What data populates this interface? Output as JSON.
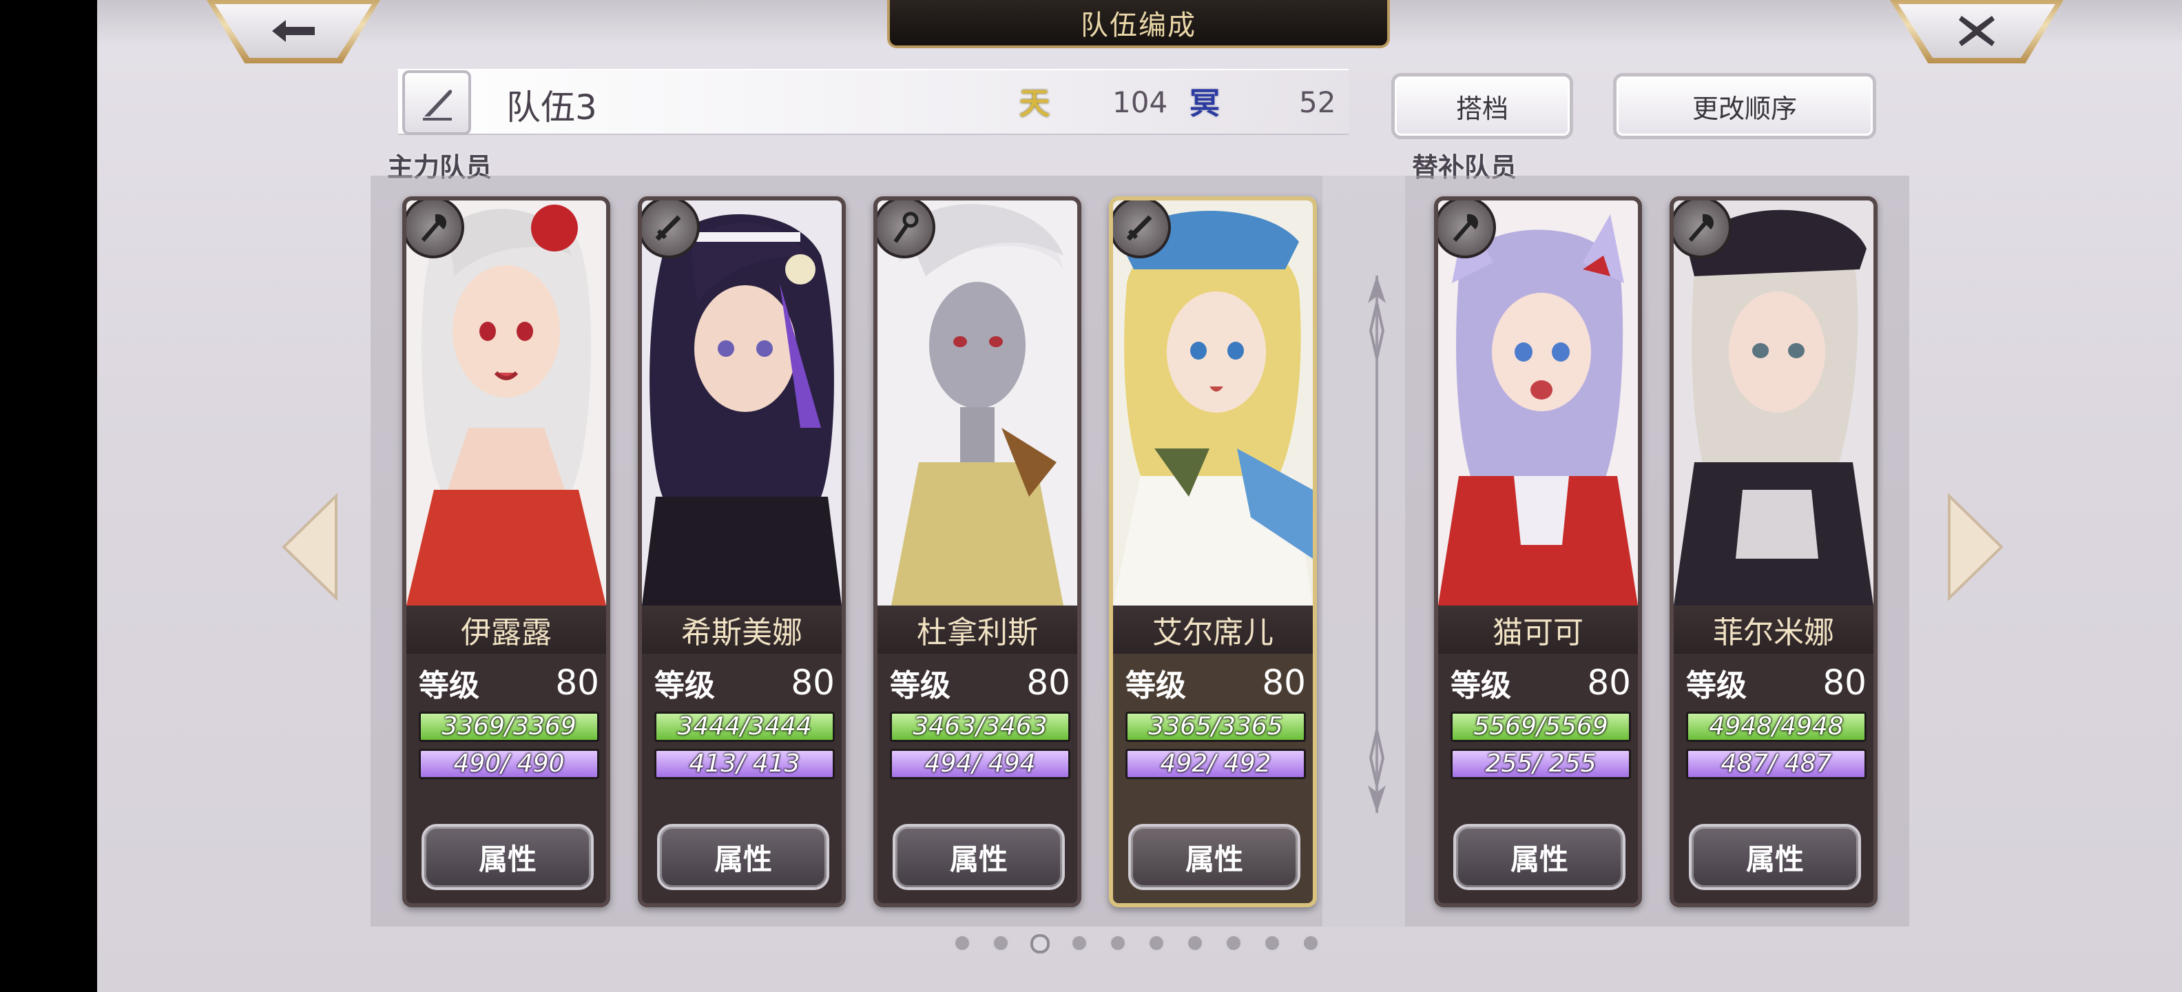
{
  "header": {
    "title": "队伍编成",
    "back_icon": "arrow-left-icon",
    "close_icon": "close-icon"
  },
  "team": {
    "name": "队伍3",
    "cost_heaven_glyph": "天",
    "cost_heaven": "104",
    "cost_hell_glyph": "冥",
    "cost_hell": "52",
    "partner_button": "搭档",
    "reorder_button": "更改顺序"
  },
  "sections": {
    "main": "主力队员",
    "sub": "替补队员"
  },
  "labels": {
    "level": "等级",
    "attr_button": "属性"
  },
  "members": [
    {
      "name": "伊露露",
      "level": "80",
      "hp": "3369/3369",
      "mp": "490/ 490",
      "weapon": "axe-icon"
    },
    {
      "name": "希斯美娜",
      "level": "80",
      "hp": "3444/3444",
      "mp": "413/ 413",
      "weapon": "sword-icon"
    },
    {
      "name": "杜拿利斯",
      "level": "80",
      "hp": "3463/3463",
      "mp": "494/ 494",
      "weapon": "staff-icon"
    },
    {
      "name": "艾尔席儿",
      "level": "80",
      "hp": "3365/3365",
      "mp": "492/ 492",
      "weapon": "sword-icon",
      "leader": true
    },
    {
      "name": "猫可可",
      "level": "80",
      "hp": "5569/5569",
      "mp": "255/ 255",
      "weapon": "axe-icon"
    },
    {
      "name": "菲尔米娜",
      "level": "80",
      "hp": "4948/4948",
      "mp": "487/ 487",
      "weapon": "axe-icon"
    }
  ],
  "pagination": {
    "pages": 10,
    "current": 3
  },
  "colors": {
    "hp": "#6cbf3a",
    "mp": "#a472e6",
    "gold": "#d9c27e",
    "heaven": "#d8b840",
    "hell": "#2a3aa0"
  }
}
